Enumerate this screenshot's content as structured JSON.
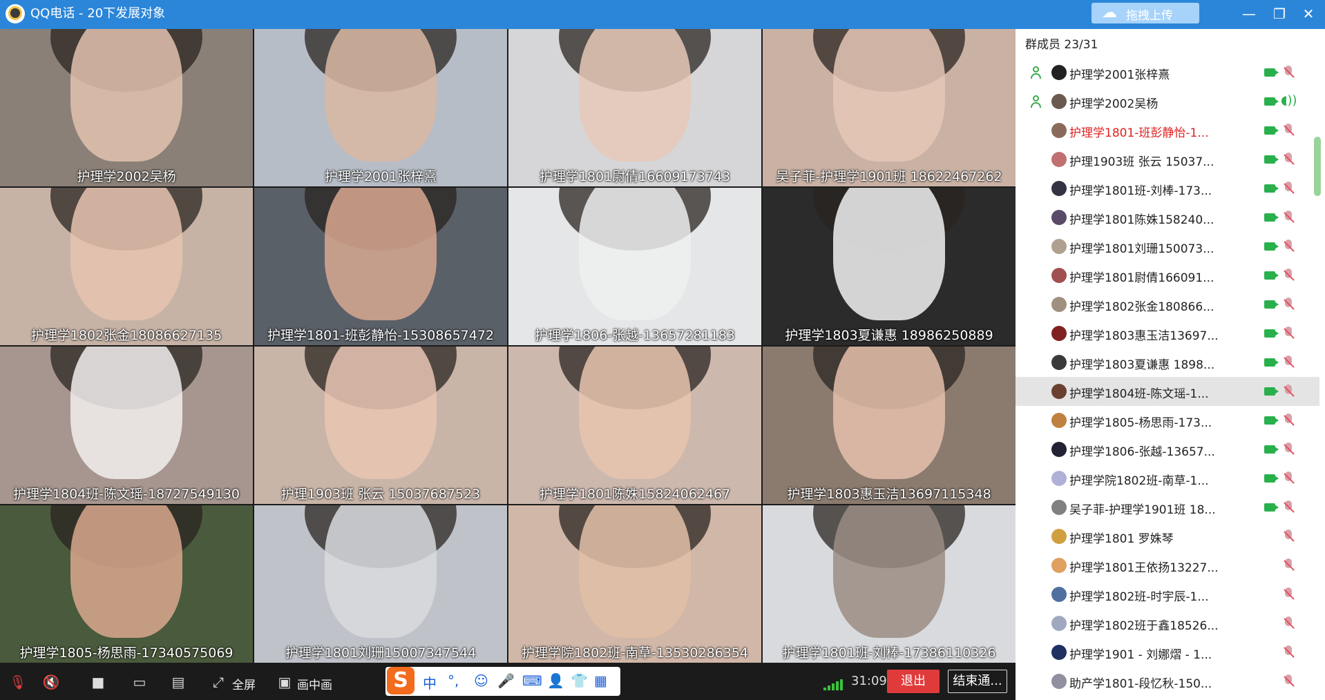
{
  "window": {
    "title": "QQ电话 - 20下发展对象",
    "upload_label": "拖拽上传",
    "minimize": "—",
    "restore": "❐",
    "close": "✕"
  },
  "tiles": [
    {
      "name": "护理学2002吴杨",
      "bg": "#8a8078",
      "face": "#e2c2ae"
    },
    {
      "name": "护理学2001张梓熹",
      "bg": "#b7bdc6",
      "face": "#d9b7a2"
    },
    {
      "name": "护理学1801尉倩16609173743",
      "bg": "#d6d6d8",
      "face": "#e6c9b8"
    },
    {
      "name": "吴子菲-护理学1901班 18622467262",
      "bg": "#c9b2a4",
      "face": "#e5c7b6"
    },
    {
      "name": "护理学1802张金18086627135",
      "bg": "#c7b3a6",
      "face": "#e6c4b0"
    },
    {
      "name": "护理学1801-班彭静怡-15308657472",
      "bg": "#5a6068",
      "face": "#d8a892"
    },
    {
      "name": "护理学1806-张越-13657281183",
      "bg": "#e5e6e8",
      "face": "#eeeeee"
    },
    {
      "name": "护理学1803夏谦惠 18986250889",
      "bg": "#2b2b2b",
      "face": "#f2f2f2"
    },
    {
      "name": "护理学1804班-陈文瑶-18727549130",
      "bg": "#a6968f",
      "face": "#f2efee"
    },
    {
      "name": "护理1903班 张云 15037687523",
      "bg": "#c9b4a8",
      "face": "#e9c6b3"
    },
    {
      "name": "护理学1801陈姝15824062467",
      "bg": "#cdb8ae",
      "face": "#e8c4ae"
    },
    {
      "name": "护理学1803惠玉洁13697115348",
      "bg": "#8b7b6f",
      "face": "#e5c1ad"
    },
    {
      "name": "护理学1805-杨思雨-17340575069",
      "bg": "#4a5a3c",
      "face": "#d9a88e"
    },
    {
      "name": "护理学1801刘珊15007347544",
      "bg": "#bfc3c9",
      "face": "#d8dade"
    },
    {
      "name": "护理学院1802班-南草-13530286354",
      "bg": "#d1b7a8",
      "face": "#e2c0a8"
    },
    {
      "name": "护理学1801班-刘棒-17386110326",
      "bg": "#d9dadd",
      "face": "#9a8c84"
    }
  ],
  "members_count": "群成员 23/31",
  "members": [
    {
      "name": "护理学2001张梓熹",
      "host": true,
      "cam": true,
      "state": "muted",
      "red": false,
      "avatar": "#222"
    },
    {
      "name": "护理学2002吴杨",
      "host": true,
      "cam": true,
      "state": "speaking",
      "red": false,
      "avatar": "#6a5a50"
    },
    {
      "name": "护理学1801-班彭静怡-1...",
      "host": false,
      "cam": true,
      "state": "muted",
      "red": true,
      "avatar": "#8a6a5a"
    },
    {
      "name": "护理1903班 张云 15037...",
      "host": false,
      "cam": true,
      "state": "muted",
      "red": false,
      "avatar": "#c07070"
    },
    {
      "name": "护理学1801班-刘棒-173...",
      "host": false,
      "cam": true,
      "state": "muted",
      "red": false,
      "avatar": "#334"
    },
    {
      "name": "护理学1801陈姝158240...",
      "host": false,
      "cam": true,
      "state": "muted",
      "red": false,
      "avatar": "#5a4a6a"
    },
    {
      "name": "护理学1801刘珊150073...",
      "host": false,
      "cam": true,
      "state": "muted",
      "red": false,
      "avatar": "#b0a090"
    },
    {
      "name": "护理学1801尉倩166091...",
      "host": false,
      "cam": true,
      "state": "muted",
      "red": false,
      "avatar": "#a05050"
    },
    {
      "name": "护理学1802张金180866...",
      "host": false,
      "cam": true,
      "state": "muted",
      "red": false,
      "avatar": "#a09080"
    },
    {
      "name": "护理学1803惠玉洁13697...",
      "host": false,
      "cam": true,
      "state": "muted",
      "red": false,
      "avatar": "#802020"
    },
    {
      "name": "护理学1803夏谦惠 1898...",
      "host": false,
      "cam": true,
      "state": "muted",
      "red": false,
      "avatar": "#3a3a3a"
    },
    {
      "name": "护理学1804班-陈文瑶-1...",
      "host": false,
      "cam": true,
      "state": "muted",
      "red": false,
      "avatar": "#6a4030",
      "selected": true
    },
    {
      "name": "护理学1805-杨思雨-173...",
      "host": false,
      "cam": true,
      "state": "muted",
      "red": false,
      "avatar": "#c08040"
    },
    {
      "name": "护理学1806-张越-13657...",
      "host": false,
      "cam": true,
      "state": "muted",
      "red": false,
      "avatar": "#223"
    },
    {
      "name": "护理学院1802班-南草-1...",
      "host": false,
      "cam": true,
      "state": "muted",
      "red": false,
      "avatar": "#b0b0d8"
    },
    {
      "name": "吴子菲-护理学1901班 18...",
      "host": false,
      "cam": true,
      "state": "muted",
      "red": false,
      "avatar": "#808080"
    },
    {
      "name": "护理学1801 罗姝琴",
      "host": false,
      "cam": false,
      "state": "muted",
      "red": false,
      "avatar": "#d0a040"
    },
    {
      "name": "护理学1801王依扬13227...",
      "host": false,
      "cam": false,
      "state": "muted",
      "red": false,
      "avatar": "#e0a060"
    },
    {
      "name": "护理学1802班-时宇辰-1...",
      "host": false,
      "cam": false,
      "state": "muted",
      "red": false,
      "avatar": "#5070a0"
    },
    {
      "name": "护理学1802班于鑫18526...",
      "host": false,
      "cam": false,
      "state": "muted",
      "red": false,
      "avatar": "#a0a8c0"
    },
    {
      "name": "护理学1901 - 刘娜熠 - 1...",
      "host": false,
      "cam": false,
      "state": "muted",
      "red": false,
      "avatar": "#203060"
    },
    {
      "name": "助产学1801-段忆秋-150...",
      "host": false,
      "cam": false,
      "state": "muted",
      "red": false,
      "avatar": "#9090a0"
    }
  ],
  "controls": {
    "fullscreen": "全屏",
    "pip": "画中画",
    "time": "31:09",
    "exit": "退出",
    "end_call": "结束通..."
  },
  "ime": {
    "logo": "S",
    "items": [
      "中",
      "°,",
      "☺",
      "🎤",
      "⌨",
      "👤",
      "👕",
      "▦"
    ]
  }
}
